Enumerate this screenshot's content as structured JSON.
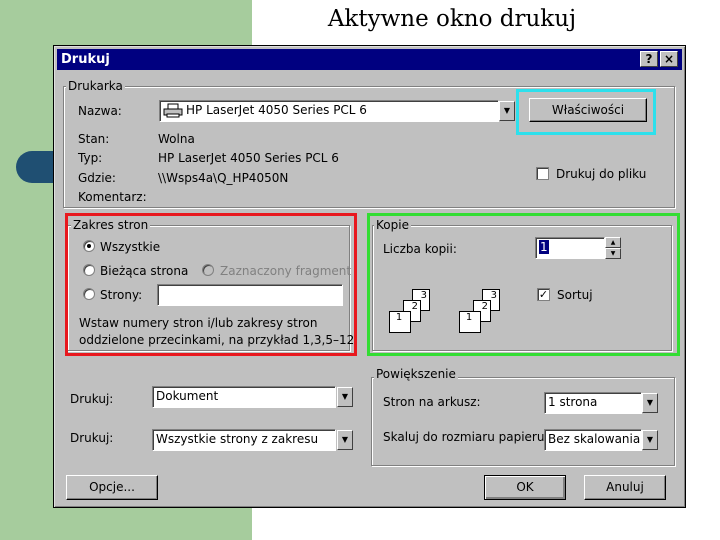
{
  "slide": {
    "title": "Aktywne okno drukuj"
  },
  "dialog": {
    "title": "Drukuj",
    "help_button": "?",
    "close_button": "×",
    "printer": {
      "group_label": "Drukarka",
      "name_label": "Nazwa:",
      "name_value": "HP LaserJet 4050 Series PCL 6",
      "properties_button": "Właściwości",
      "status_label": "Stan:",
      "status_value": "Wolna",
      "type_label": "Typ:",
      "type_value": "HP LaserJet 4050 Series PCL 6",
      "where_label": "Gdzie:",
      "where_value": "\\\\Wsps4a\\Q_HP4050N",
      "comment_label": "Komentarz:",
      "print_to_file_label": "Drukuj do pliku"
    },
    "page_range": {
      "group_label": "Zakres stron",
      "all_label": "Wszystkie",
      "current_label": "Bieżąca strona",
      "selection_label": "Zaznaczony fragment",
      "pages_label": "Strony:",
      "pages_value": "",
      "hint_line1": "Wstaw numery stron i/lub zakresy stron",
      "hint_line2": "oddzielone przecinkami, na przykład 1,3,5–12"
    },
    "copies": {
      "group_label": "Kopie",
      "count_label": "Liczba kopii:",
      "count_value": "1",
      "collate_label": "Sortuj",
      "collate_checked": true,
      "page_numbers": [
        "3",
        "2",
        "1"
      ]
    },
    "print_what": {
      "label": "Drukuj:",
      "value": "Dokument"
    },
    "print_range": {
      "label": "Drukuj:",
      "value": "Wszystkie strony z zakresu"
    },
    "zoom": {
      "group_label": "Powiększenie",
      "pages_per_sheet_label": "Stron na arkusz:",
      "pages_per_sheet_value": "1 strona",
      "scale_label": "Skaluj do rozmiaru papieru:",
      "scale_value": "Bez skalowania"
    },
    "options_button": "Opcje...",
    "ok_button": "OK",
    "cancel_button": "Anuluj"
  },
  "colors": {
    "titlebar": "#000080",
    "dialog_face": "#c0c0c0",
    "left_band": "#a6cc9d",
    "highlight_properties": "#2de0ec",
    "highlight_page_range": "#e8181e",
    "highlight_copies": "#33dd33"
  },
  "icons": [
    "printer-icon",
    "dropdown-arrow-icon",
    "spin-up-icon",
    "spin-down-icon",
    "collate-pages-icon"
  ]
}
